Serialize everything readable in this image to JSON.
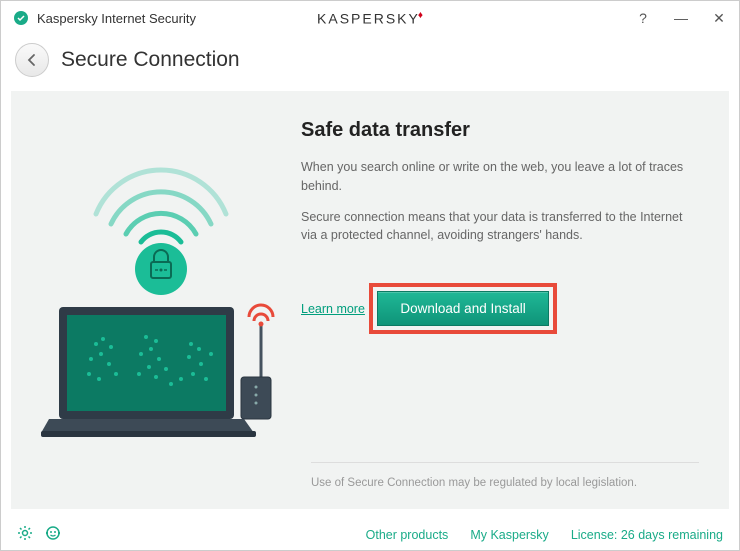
{
  "header": {
    "app_title": "Kaspersky Internet Security",
    "brand": "KASPERSKY"
  },
  "page": {
    "title": "Secure Connection"
  },
  "content": {
    "heading": "Safe data transfer",
    "para1": "When you search online or write on the web, you leave a lot of traces behind.",
    "para2": "Secure connection means that your data is transferred to the Internet via a protected channel, avoiding strangers' hands.",
    "learn_more": "Learn more",
    "cta": "Download and Install",
    "footer_note": "Use of Secure Connection may be regulated by local legislation."
  },
  "bottom": {
    "other_products": "Other products",
    "my_kaspersky": "My Kaspersky",
    "license": "License: 26 days remaining"
  }
}
